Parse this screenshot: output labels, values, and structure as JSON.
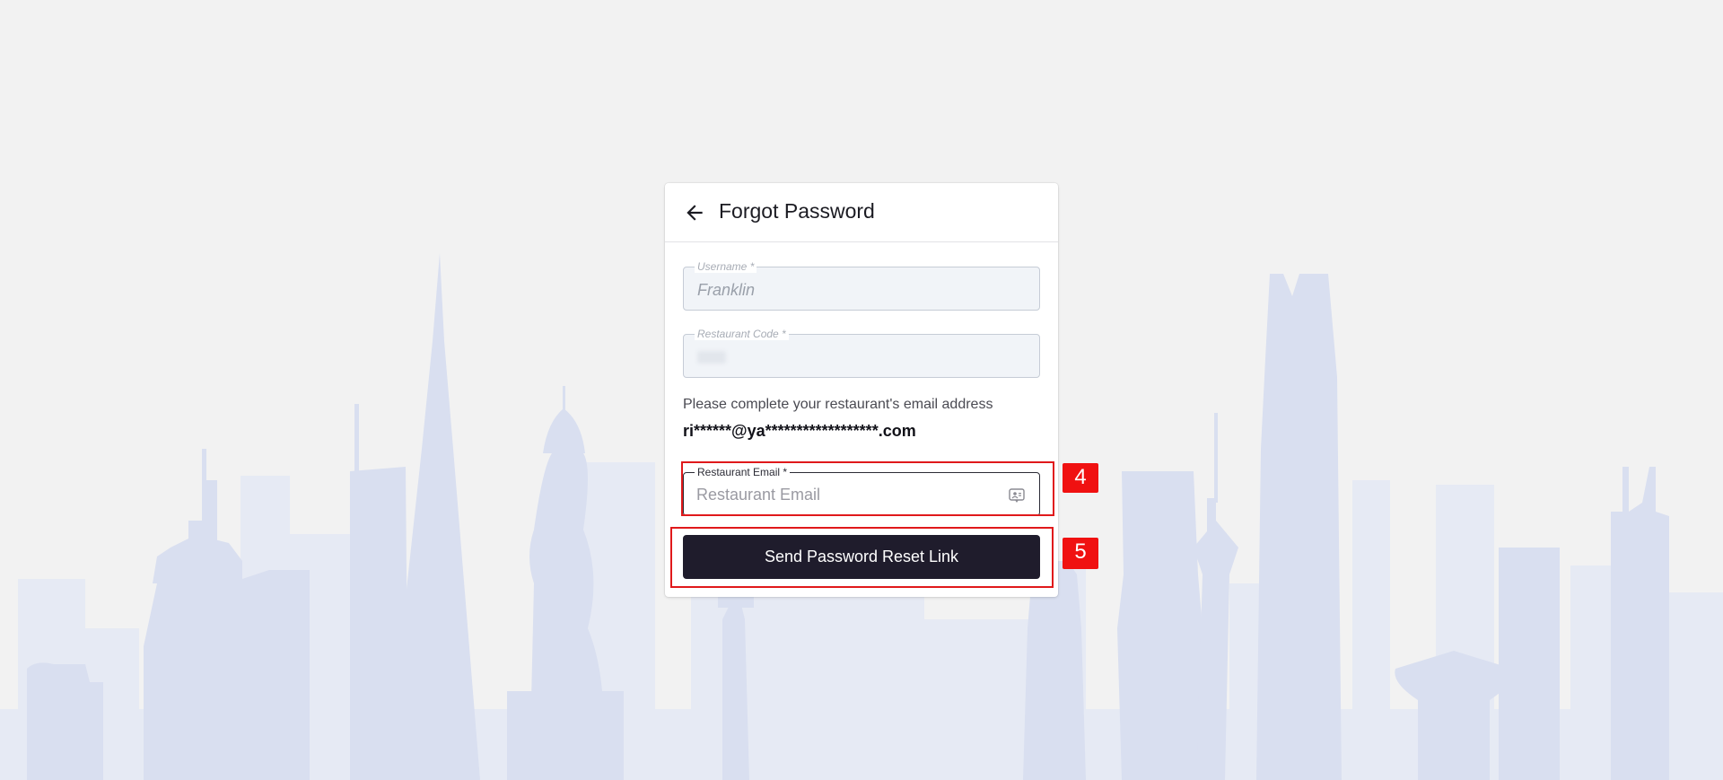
{
  "header": {
    "title": "Forgot Password"
  },
  "username": {
    "label": "Username *",
    "value": "Franklin"
  },
  "restaurant_code": {
    "label": "Restaurant Code *"
  },
  "email_hint": "Please complete your restaurant's email address",
  "masked_email": "ri******@ya******************.com",
  "restaurant_email": {
    "label": "Restaurant Email *",
    "placeholder": "Restaurant Email"
  },
  "send_button": {
    "label": "Send Password Reset Link"
  },
  "annotations": [
    "4",
    "5"
  ],
  "colors": {
    "button_bg": "#1f1c2c",
    "annotation_red": "#e0191b",
    "page_bg": "#f2f2f2",
    "skyline": "#dde3f1"
  },
  "icons": {
    "back": "arrow-left-icon",
    "contact": "contact-card-icon"
  }
}
